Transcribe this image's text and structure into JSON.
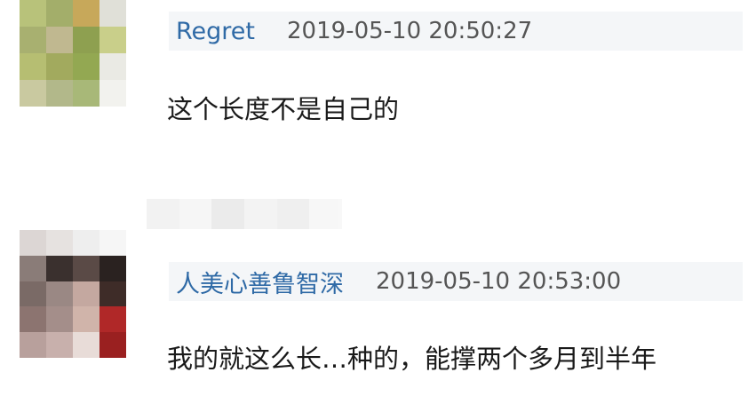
{
  "comments": [
    {
      "username": "Regret",
      "timestamp": "2019-05-10 20:50:27",
      "text": "这个长度不是自己的",
      "avatar_colors": [
        "#b8c27a",
        "#a3ae6a",
        "#c7a85a",
        "#e0e0d8",
        "#a8b070",
        "#c0b890",
        "#8ea050",
        "#c9cf8a",
        "#b6be72",
        "#a2aa5e",
        "#93a852",
        "#eaeae4",
        "#c9c9a0",
        "#b2b88a",
        "#a8b878",
        "#f2f2ee"
      ]
    },
    {
      "username": "人美心善鲁智深",
      "timestamp": "2019-05-10 20:53:00",
      "text": "我的就这么长…种的，能撑两个多月到半年",
      "avatar_colors": [
        "#dcd6d4",
        "#e6e2e0",
        "#eeeeee",
        "#f6f6f6",
        "#8a7c78",
        "#3a302e",
        "#5a4a46",
        "#2a2220",
        "#7a6a66",
        "#9a8884",
        "#c4a8a0",
        "#3e2c28",
        "#8c7470",
        "#a48e8a",
        "#d0b4aa",
        "#b02828",
        "#b8a09c",
        "#c8b0ac",
        "#e8dcd8",
        "#9a2020"
      ]
    }
  ],
  "blur_colors": [
    "#e8e8e8",
    "#f0f0f0",
    "#dcdcdc",
    "#ebebeb",
    "#e2e2e2",
    "#f2f2f2"
  ]
}
